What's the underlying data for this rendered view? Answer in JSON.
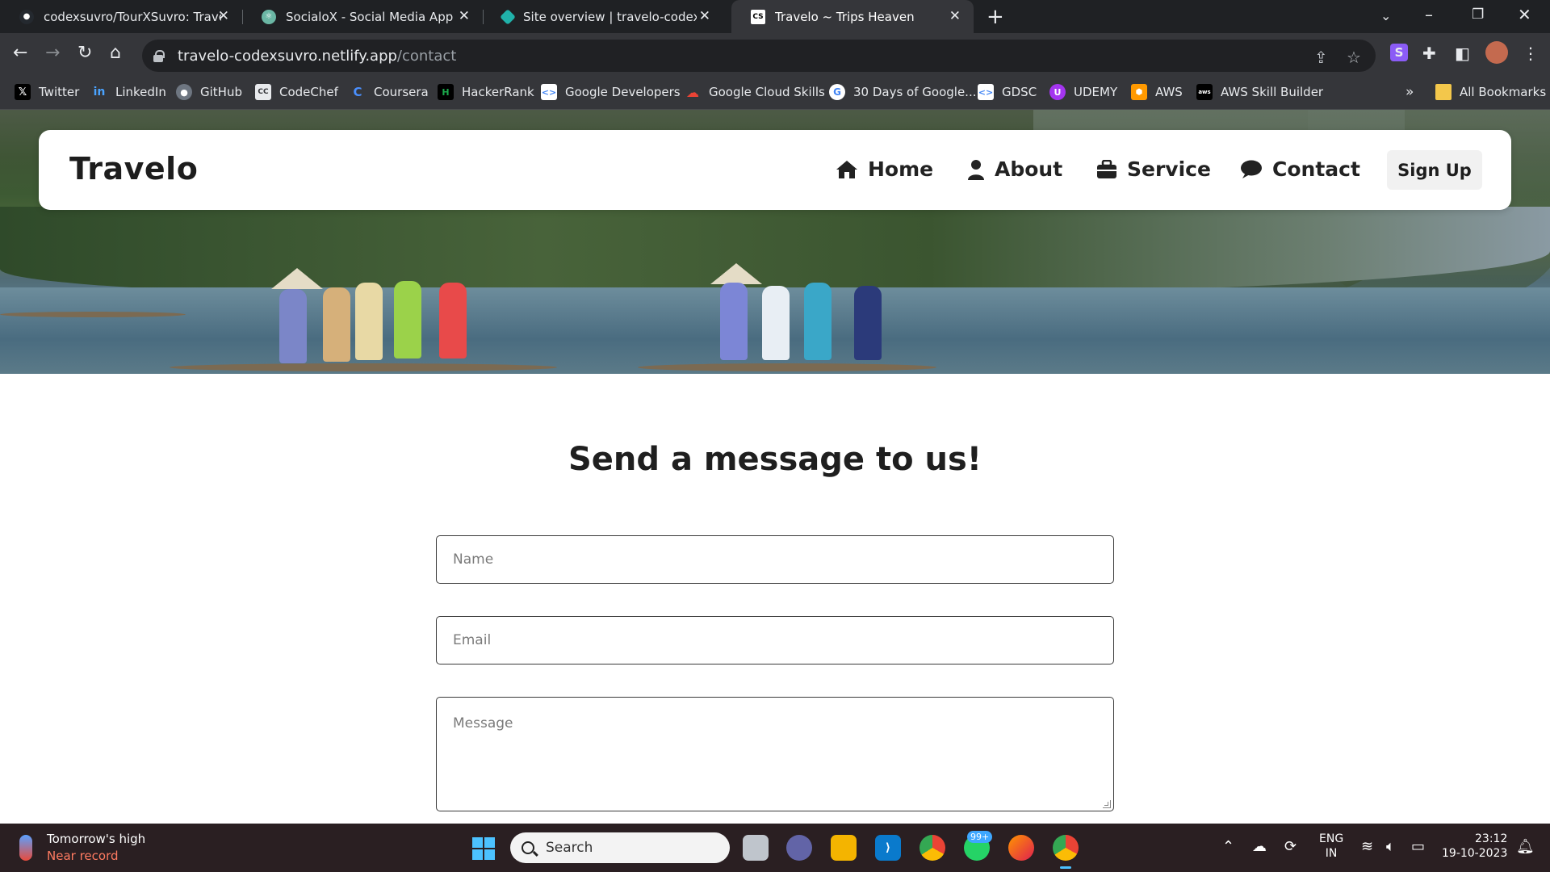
{
  "browser": {
    "tabs": [
      {
        "title": "codexsuvro/TourXSuvro: Travel a",
        "favicon": "github-icon"
      },
      {
        "title": "SocialoX - Social Media App",
        "favicon": "react-icon"
      },
      {
        "title": "Site overview | travelo-codexsuv",
        "favicon": "netlify-icon"
      },
      {
        "title": "Travelo ~ Trips Heaven",
        "favicon": "codexsuvro-icon"
      }
    ],
    "url_host": "travelo-codexsuvro.netlify.app",
    "url_path": "/contact",
    "bookmarks": [
      {
        "label": "Twitter",
        "icon": "x-icon",
        "color": "#000000"
      },
      {
        "label": "LinkedIn",
        "icon": "linkedin-icon",
        "color": "#0a66c2"
      },
      {
        "label": "GitHub",
        "icon": "github-icon",
        "color": "#444444"
      },
      {
        "label": "CodeChef",
        "icon": "codechef-icon",
        "color": "#5b4638"
      },
      {
        "label": "Coursera",
        "icon": "coursera-icon",
        "color": "#0056d2"
      },
      {
        "label": "HackerRank",
        "icon": "hackerrank-icon",
        "color": "#1ba94c"
      },
      {
        "label": "Google Developers",
        "icon": "google-developers-icon",
        "color": "#4285f4"
      },
      {
        "label": "Google Cloud Skills",
        "icon": "google-cloud-icon",
        "color": "#ea4335"
      },
      {
        "label": "30 Days of Google...",
        "icon": "google-icon",
        "color": "#ffffff"
      },
      {
        "label": "GDSC",
        "icon": "gdsc-icon",
        "color": "#4285f4"
      },
      {
        "label": "UDEMY",
        "icon": "udemy-icon",
        "color": "#a435f0"
      },
      {
        "label": "AWS",
        "icon": "aws-icon",
        "color": "#ff9900"
      },
      {
        "label": "AWS Skill Builder",
        "icon": "aws-skill-builder-icon",
        "color": "#232f3e"
      }
    ],
    "bookmarks_overflow": "»",
    "all_bookmarks": "All Bookmarks"
  },
  "site": {
    "brand": "Travelo",
    "nav": [
      {
        "label": "Home",
        "icon": "home-icon"
      },
      {
        "label": "About",
        "icon": "user-icon"
      },
      {
        "label": "Service",
        "icon": "briefcase-icon"
      },
      {
        "label": "Contact",
        "icon": "chat-icon"
      }
    ],
    "signup": "Sign Up"
  },
  "contact": {
    "heading": "Send a message to us!",
    "name_placeholder": "Name",
    "email_placeholder": "Email",
    "message_placeholder": "Message"
  },
  "taskbar": {
    "weather_title": "Tomorrow's high",
    "weather_sub": "Near record",
    "search_label": "Search",
    "notification_badge": "99+",
    "lang_line1": "ENG",
    "lang_line2": "IN",
    "time": "23:12",
    "date": "19-10-2023"
  },
  "colors": {
    "accent": "#1f1f1f",
    "taskbar": "#2a1f22",
    "browser_frame": "#35363a"
  }
}
